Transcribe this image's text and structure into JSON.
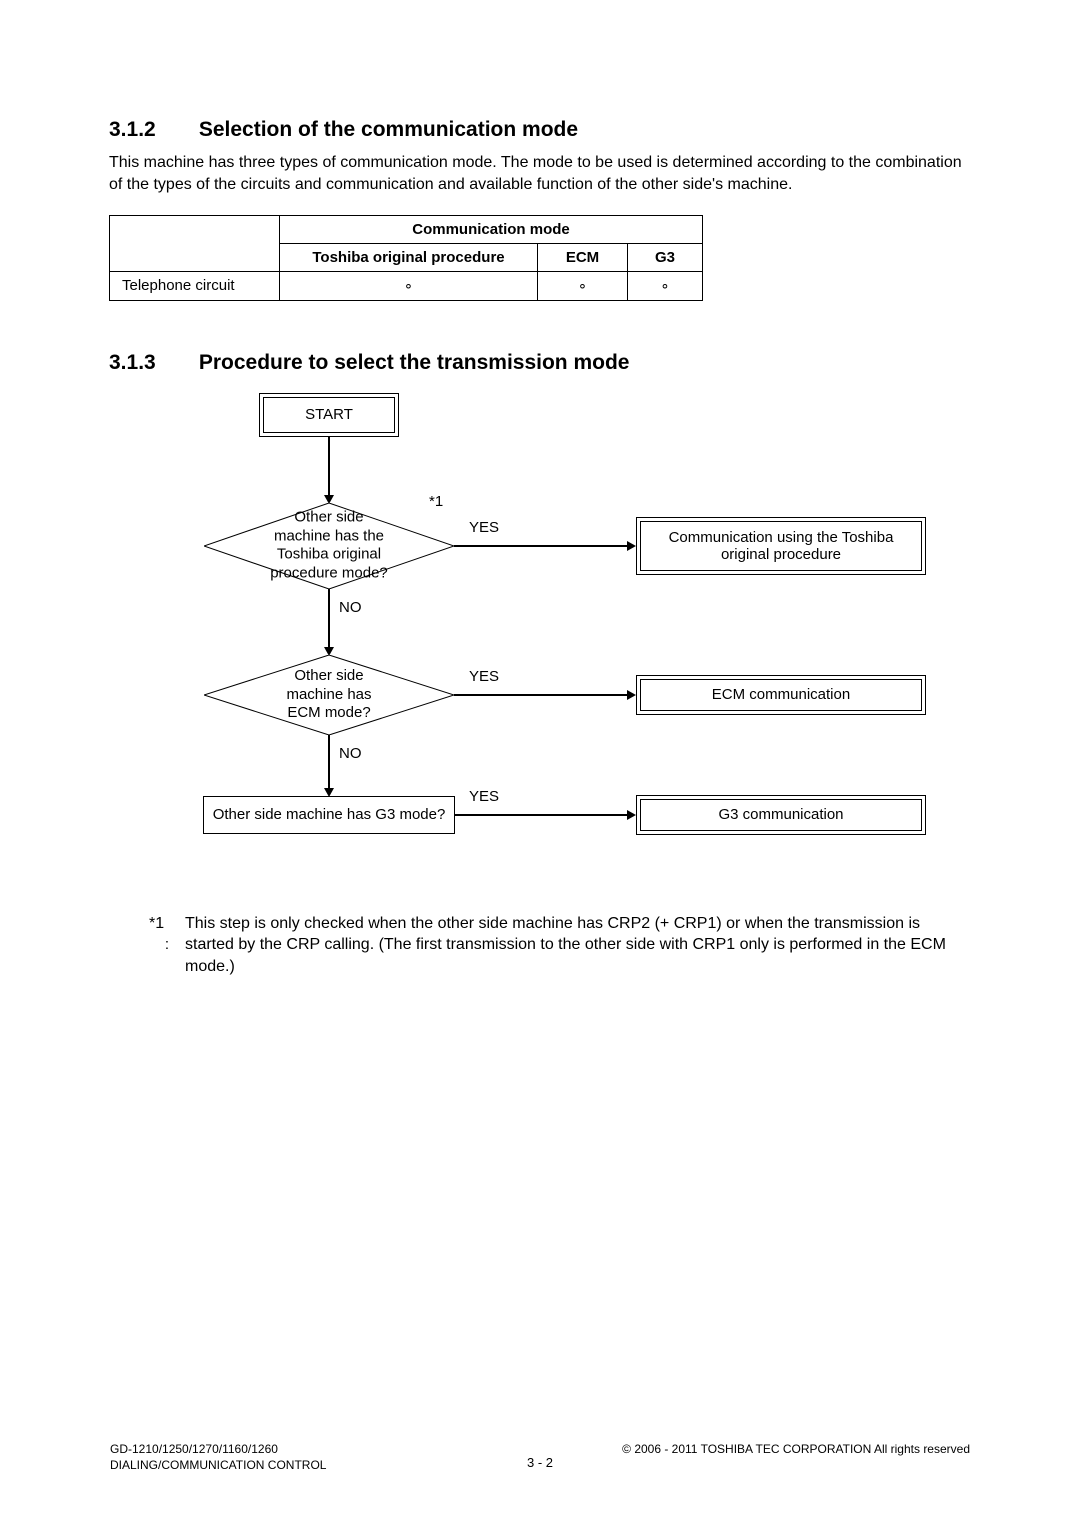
{
  "section1": {
    "number": "3.1.2",
    "title": "Selection of the communication mode",
    "paragraph": "This machine has three types of communication mode. The mode to be used is determined according to the combination of the types of the circuits and communication and available function of the other side's machine."
  },
  "table": {
    "merged_header": "Communication mode",
    "headers": {
      "col_a": "Toshiba original procedure",
      "col_b": "ECM",
      "col_c": "G3"
    },
    "row_label": "Telephone circuit",
    "mark": "∘"
  },
  "section2": {
    "number": "3.1.3",
    "title": "Procedure to select the transmission mode"
  },
  "flowchart": {
    "start": "START",
    "star1": "*1",
    "decision1": "Other side machine has the\nToshiba original\nprocedure mode?",
    "decision2": "Other side machine has\nECM mode?",
    "decision3": "Other side machine has G3 mode?",
    "yes": "YES",
    "no": "NO",
    "result1": "Communication using the Toshiba original procedure",
    "result2": "ECM communication",
    "result3": "G3 communication"
  },
  "footnote": {
    "marker_top": "*1",
    "marker_sub": ":",
    "text": "This step is only checked when the other side machine has CRP2 (+ CRP1) or when the transmission is started by the CRP calling. (The first transmission to the other side with CRP1 only is performed in the ECM mode.)"
  },
  "footer": {
    "left_line1": "GD-1210/1250/1270/1160/1260",
    "left_line2": "DIALING/COMMUNICATION CONTROL",
    "right": "© 2006 - 2011 TOSHIBA TEC CORPORATION All rights reserved",
    "page": "3 - 2"
  }
}
